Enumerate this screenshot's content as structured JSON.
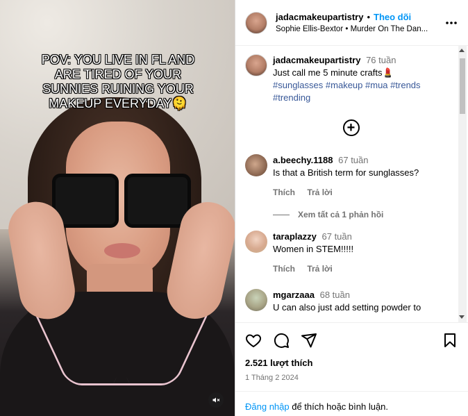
{
  "video": {
    "caption_text": "POV: YOU LIVE IN FL AND ARE TIRED OF YOUR SUNNIES RUINING YOUR MAKEUP EVERYDAY🫠",
    "mute_icon": "speaker-muted-icon"
  },
  "header": {
    "username": "jadacmakeupartistry",
    "separator": "•",
    "follow_label": "Theo dõi",
    "audio": "Sophie Ellis-Bextor • Murder On The Dan...",
    "more_label": "•••"
  },
  "caption": {
    "username": "jadacmakeupartistry",
    "time": "76 tuần",
    "text": "Just call me 5 minute crafts💄",
    "hashtags": [
      "#sunglasses",
      "#makeup",
      "#mua",
      "#trends",
      "#trending"
    ]
  },
  "load_more_label": "+",
  "comments": [
    {
      "username": "a.beechy.1188",
      "time": "67 tuần",
      "text": "Is that a British term for sunglasses?",
      "like_label": "Thích",
      "reply_label": "Trả lời",
      "view_replies": "Xem tất cả 1 phản hồi"
    },
    {
      "username": "taraplazzy",
      "time": "67 tuần",
      "text": "Women in STEM!!!!!",
      "like_label": "Thích",
      "reply_label": "Trả lời"
    },
    {
      "username": "mgarzaaa",
      "time": "68 tuần",
      "text": "U can also just add setting powder to"
    }
  ],
  "footer": {
    "likes": "2.521 lượt thích",
    "date": "1 Tháng 2 2024",
    "login_link": "Đăng nhập",
    "login_rest": " để thích hoặc bình luận."
  },
  "colors": {
    "accent": "#0095f6",
    "hashtag": "#385898",
    "muted": "#737373"
  }
}
